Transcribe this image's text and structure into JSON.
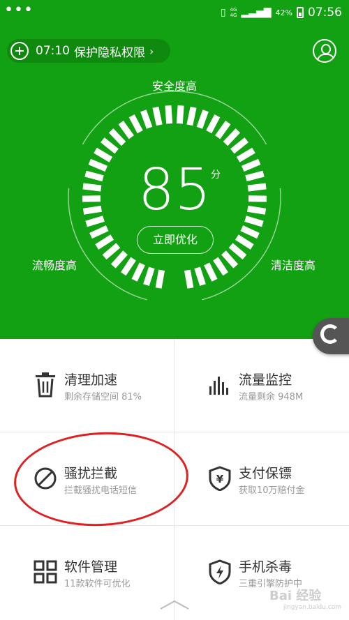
{
  "status_bar": {
    "network_top": "4G",
    "network_bottom": "4G",
    "battery": "42%",
    "time": "07:56"
  },
  "header": {
    "privacy_time": "07:10",
    "privacy_text": "保护隐私权限"
  },
  "gauge": {
    "top_label": "安全度高",
    "left_label": "流畅度高",
    "right_label": "清洁度高",
    "score": "85",
    "score_unit": "分",
    "optimize_label": "立即优化",
    "score_fraction": 0.85
  },
  "tiles": [
    {
      "title": "清理加速",
      "subtitle": "剩余存储空间 81%",
      "icon": "trash-icon"
    },
    {
      "title": "流量监控",
      "subtitle": "流量剩余 948M",
      "icon": "bar-chart-icon"
    },
    {
      "title": "骚扰拦截",
      "subtitle": "拦截骚扰电话短信",
      "icon": "block-icon"
    },
    {
      "title": "支付保镖",
      "subtitle": "获取10万赔付金",
      "icon": "shield-yen-icon"
    },
    {
      "title": "软件管理",
      "subtitle": "11款软件可优化",
      "icon": "apps-grid-icon"
    },
    {
      "title": "手机杀毒",
      "subtitle": "三重引擎防护中",
      "icon": "shield-bolt-icon"
    }
  ],
  "watermark": {
    "text": "Bai 经验",
    "sub": "jingyan.baidu.com"
  },
  "colors": {
    "hero_green": "#12a112",
    "annotation_red": "#e02020"
  }
}
